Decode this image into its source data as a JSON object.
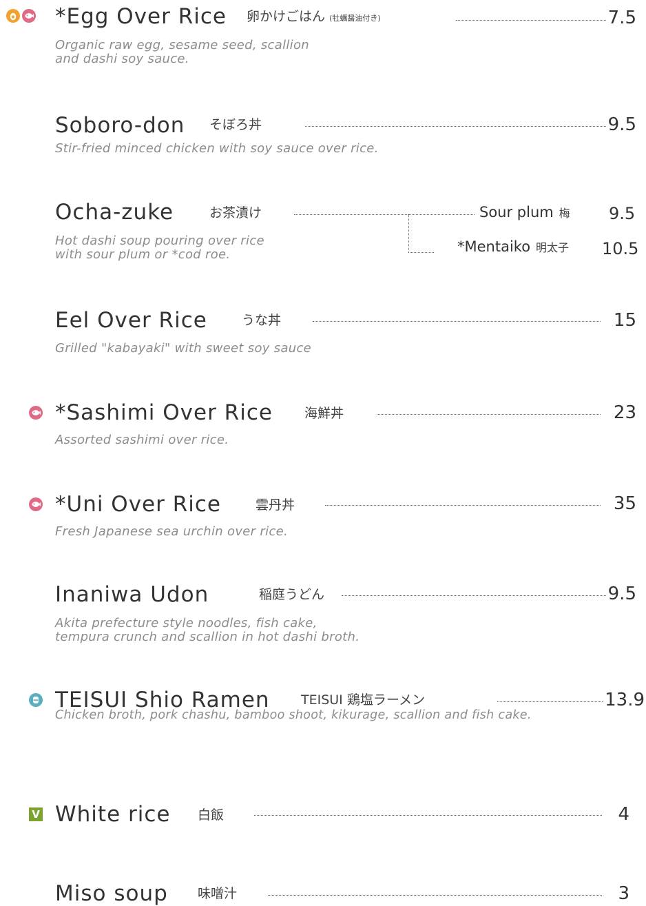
{
  "colors": {
    "egg": "#f2a22f",
    "raw": "#e06a86",
    "pork": "#5aafc0",
    "veg": "#7aa332"
  },
  "items": [
    {
      "name": "*Egg Over Rice",
      "jp": "卵かけごはん",
      "jp_note": "(牡蠣醤油付き)",
      "price": "7.5",
      "desc": "Organic raw egg, sesame seed, scallion\nand dashi soy sauce.",
      "icons": [
        "egg-icon",
        "raw-fish-icon"
      ]
    },
    {
      "name": "Soboro-don",
      "jp": "そぼろ丼",
      "price": "9.5",
      "desc": "Stir-fried minced chicken with soy sauce over rice."
    },
    {
      "name": "Ocha-zuke",
      "jp": "お茶漬け",
      "desc": "Hot dashi soup pouring over rice\nwith sour plum or *cod roe.",
      "options": [
        {
          "label": "Sour plum",
          "jp": "梅",
          "price": "9.5"
        },
        {
          "label": "*Mentaiko",
          "jp": "明太子",
          "price": "10.5"
        }
      ]
    },
    {
      "name": "Eel Over Rice",
      "jp": "うな丼",
      "price": "15",
      "desc": "Grilled \"kabayaki\" with sweet soy sauce"
    },
    {
      "name": "*Sashimi Over Rice",
      "jp": "海鮮丼",
      "price": "23",
      "desc": "Assorted sashimi over rice.",
      "icons": [
        "raw-fish-icon"
      ]
    },
    {
      "name": "*Uni Over Rice",
      "jp": "雲丹丼",
      "price": "35",
      "desc": "Fresh Japanese sea urchin over rice.",
      "icons": [
        "raw-fish-icon"
      ]
    },
    {
      "name": "Inaniwa Udon",
      "jp": "稲庭うどん",
      "price": "9.5",
      "desc": "Akita prefecture style noodles, fish cake,\ntempura crunch and scallion in hot dashi broth."
    },
    {
      "name": "TEISUI Shio Ramen",
      "jp": "TEISUI 鶏塩ラーメン",
      "price": "13.9",
      "desc": "Chicken broth, pork chashu, bamboo shoot, kikurage, scallion and fish cake.",
      "icons": [
        "pork-icon"
      ]
    },
    {
      "name": "White rice",
      "jp": "白飯",
      "price": "4",
      "icons": [
        "vegetarian-icon"
      ],
      "veg_letter": "V"
    },
    {
      "name": "Miso soup",
      "jp": "味噌汁",
      "price": "3"
    }
  ]
}
